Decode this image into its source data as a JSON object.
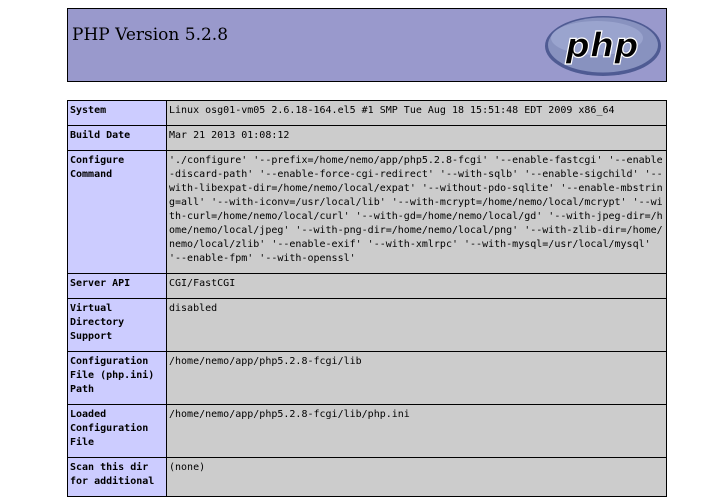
{
  "header": {
    "title": "PHP Version 5.2.8",
    "logo_text": "php",
    "colors": {
      "header_bg": "#9999cc",
      "key_bg": "#ccccff",
      "value_bg": "#cccccc",
      "logo_fill": "#8892bf",
      "logo_dark": "#4f5b93"
    }
  },
  "rows": [
    {
      "key": "System",
      "value": "Linux osg01-vm05 2.6.18-164.el5 #1 SMP Tue Aug 18 15:51:48 EDT 2009 x86_64"
    },
    {
      "key": "Build Date",
      "value": "Mar 21 2013 01:08:12"
    },
    {
      "key": "Configure Command",
      "value": "'./configure' '--prefix=/home/nemo/app/php5.2.8-fcgi' '--enable-fastcgi' '--enable-discard-path' '--enable-force-cgi-redirect' '--with-sqlb' '--enable-sigchild' '--with-libexpat-dir=/home/nemo/local/expat' '--without-pdo-sqlite' '--enable-mbstring=all' '--with-iconv=/usr/local/lib' '--with-mcrypt=/home/nemo/local/mcrypt' '--with-curl=/home/nemo/local/curl' '--with-gd=/home/nemo/local/gd' '--with-jpeg-dir=/home/nemo/local/jpeg' '--with-png-dir=/home/nemo/local/png' '--with-zlib-dir=/home/nemo/local/zlib' '--enable-exif' '--with-xmlrpc' '--with-mysql=/usr/local/mysql' '--enable-fpm' '--with-openssl'"
    },
    {
      "key": "Server API",
      "value": "CGI/FastCGI"
    },
    {
      "key": "Virtual Directory Support",
      "value": "disabled"
    },
    {
      "key": "Configuration File (php.ini) Path",
      "value": "/home/nemo/app/php5.2.8-fcgi/lib"
    },
    {
      "key": "Loaded Configuration File",
      "value": "/home/nemo/app/php5.2.8-fcgi/lib/php.ini"
    },
    {
      "key": "Scan this dir for additional",
      "value": "(none)"
    }
  ]
}
